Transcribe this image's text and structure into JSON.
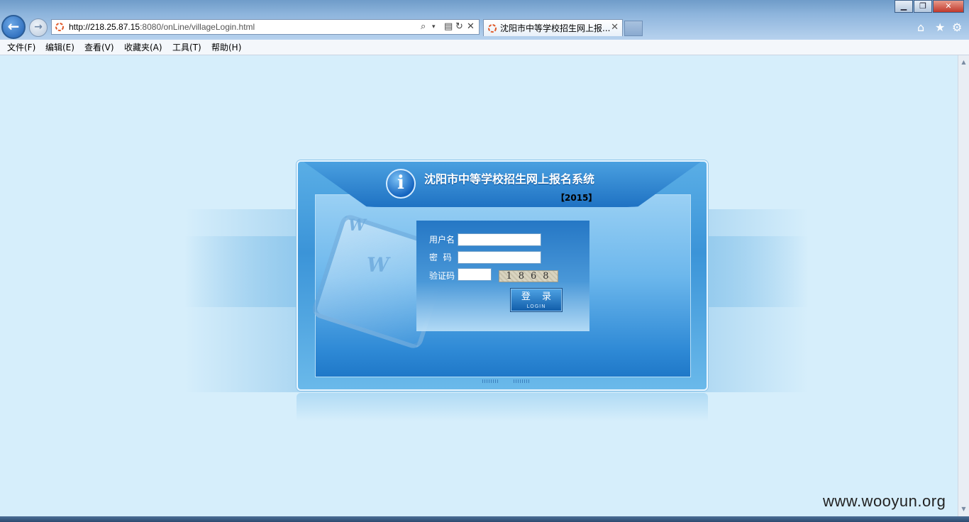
{
  "browser": {
    "url_host": "http://218.25.87.15",
    "url_rest": ":8080/onLine/villageLogin.html",
    "tab_title": "沈阳市中等学校招生网上报...",
    "window_controls": [
      "minimize-icon",
      "restore-icon",
      "close-icon"
    ],
    "toolbar_icons": [
      "home-icon",
      "favorites-star-icon",
      "gear-icon"
    ]
  },
  "menu": {
    "items": [
      "文件(F)",
      "编辑(E)",
      "查看(V)",
      "收藏夹(A)",
      "工具(T)",
      "帮助(H)"
    ]
  },
  "login_panel": {
    "title": "沈阳市中等学校招生网上报名系统",
    "year": "【2015】",
    "username_label": "用户名",
    "password_label": "密  码",
    "captcha_label": "验证码",
    "username_value": "",
    "password_value": "",
    "captcha_value": "",
    "captcha_image_text": "1868",
    "login_button_label": "登 录",
    "login_button_sublabel": "LOGIN"
  },
  "watermark": "www.wooyun.org",
  "colors": {
    "page_background": "#d6eefb",
    "panel_blue": "#3b94d8",
    "header_blue": "#1f72c3"
  }
}
